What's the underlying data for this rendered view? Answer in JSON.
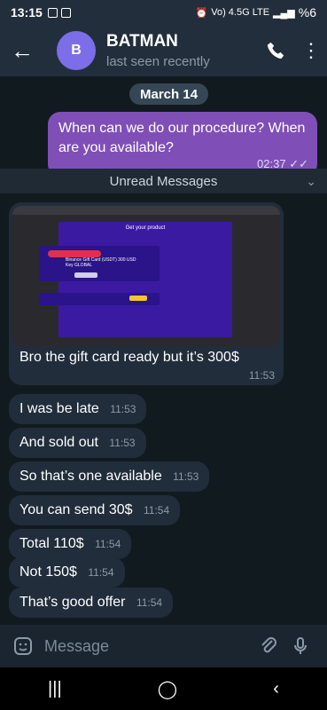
{
  "status": {
    "time": "13:15",
    "network": "Vo) 4.5G LTE",
    "battery": "%6"
  },
  "header": {
    "avatar_letter": "B",
    "name": "BATMAN",
    "status": "last seen recently"
  },
  "chat": {
    "date": "March 14",
    "outgoing": {
      "text": "When can we do our procedure? When are you available?",
      "time": "02:37"
    },
    "unread_label": "Unread Messages",
    "photo": {
      "panel_title": "Get your product",
      "card_title": "Binance Gift Card (USDT) 300 USD Key GLOBAL",
      "caption": "Bro the gift card ready but it’s 300$",
      "time": "11:53"
    },
    "messages": [
      {
        "text": "I was be late",
        "time": "11:53"
      },
      {
        "text": "And sold out",
        "time": "11:53"
      },
      {
        "text": "So that’s one available",
        "time": "11:53"
      },
      {
        "text": "You can send 30$",
        "time": "11:54"
      },
      {
        "text": "Total 110$",
        "time": "11:54"
      },
      {
        "text": "Not 150$",
        "time": "11:54"
      },
      {
        "text": "That’s good offer",
        "time": "11:54"
      }
    ]
  },
  "input": {
    "placeholder": "Message"
  },
  "icons": {
    "back": "arrow-left-icon",
    "call": "phone-icon",
    "menu": "more-vertical-icon",
    "emoji": "sticker-icon",
    "attach": "paperclip-icon",
    "mic": "microphone-icon",
    "nav_recent": "recent-apps-icon",
    "nav_home": "home-icon",
    "nav_back": "back-icon"
  },
  "colors": {
    "outgoing_bubble": "#7f4fb7",
    "avatar": "#7b6ee8",
    "incoming_bubble": "#212d3b"
  }
}
